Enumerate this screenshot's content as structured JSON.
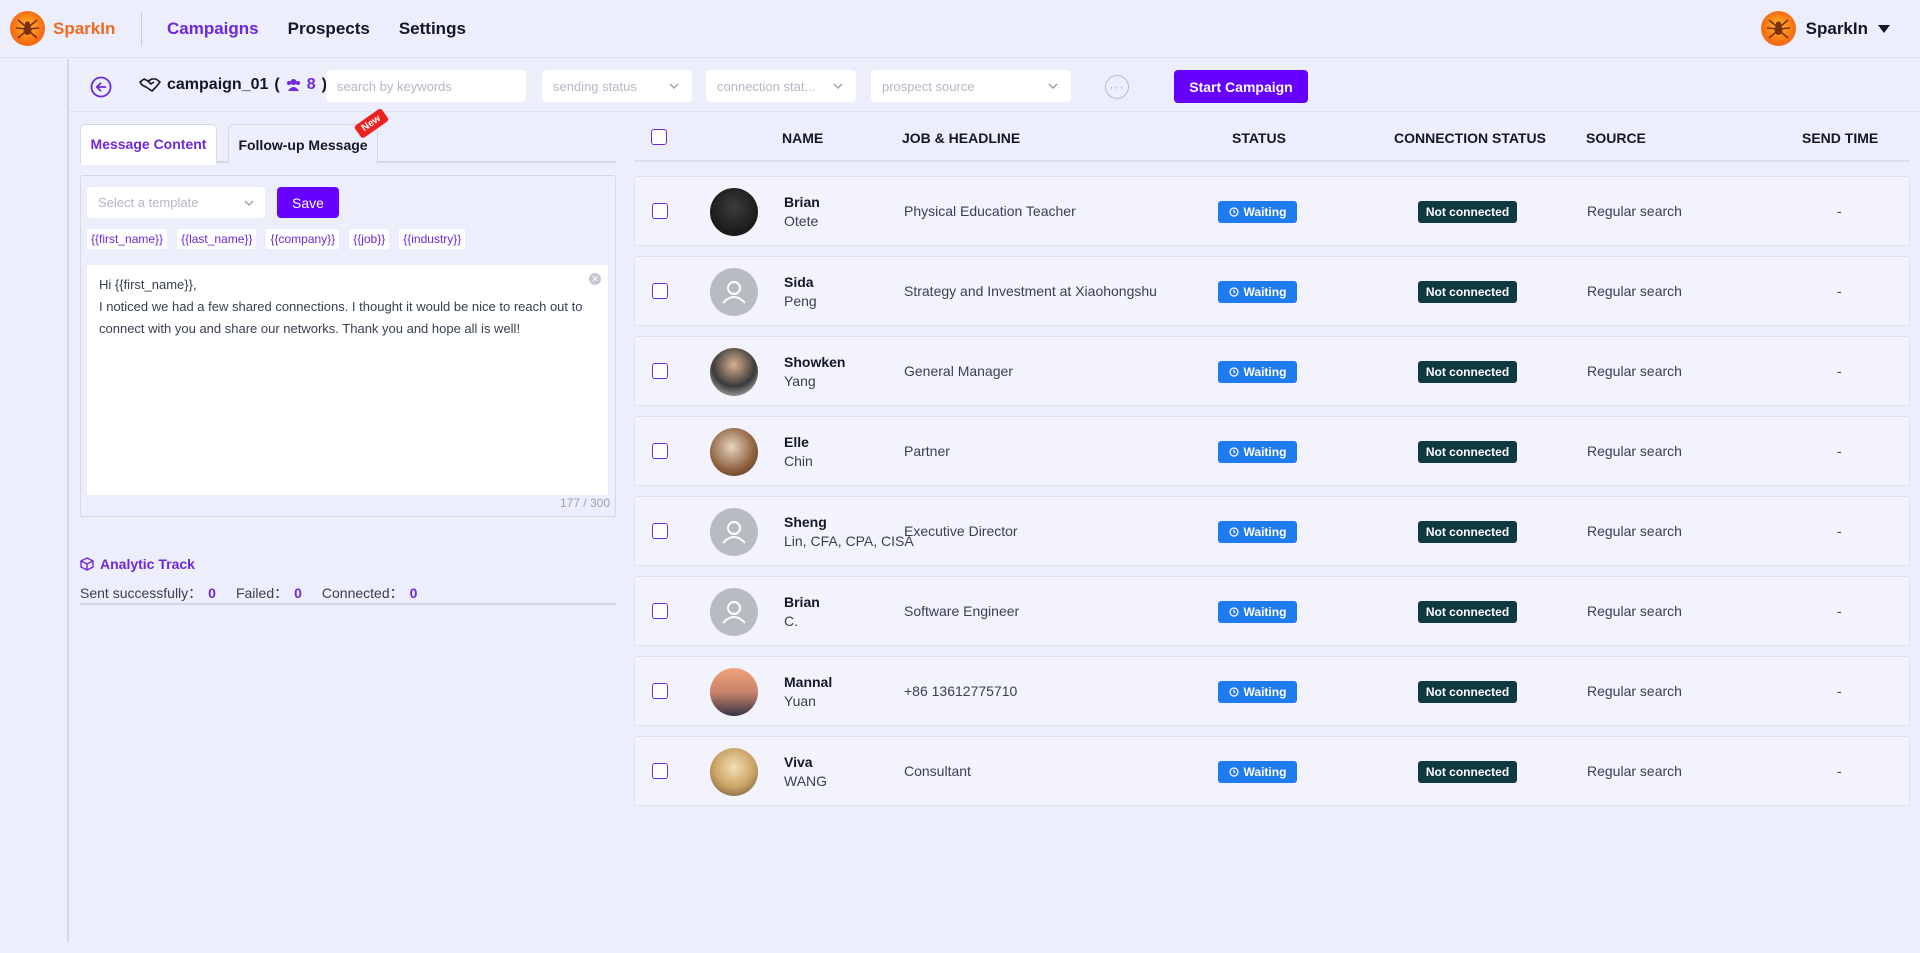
{
  "app": {
    "name": "SparkIn"
  },
  "nav": {
    "campaigns": "Campaigns",
    "prospects": "Prospects",
    "settings": "Settings"
  },
  "user": {
    "name": "SparkIn"
  },
  "toolbar": {
    "campaign_name": "campaign_01",
    "prospect_count": "8",
    "search_placeholder": "search by keywords",
    "sending_status_placeholder": "sending status",
    "connection_status_placeholder": "connection stat...",
    "prospect_source_placeholder": "prospect source",
    "more_label": "···",
    "start_label": "Start Campaign"
  },
  "message": {
    "tab_content": "Message Content",
    "tab_followup": "Follow-up Message",
    "new_badge": "New",
    "template_placeholder": "Select a template",
    "save_label": "Save",
    "tokens": [
      "{{first_name}}",
      "{{last_name}}",
      "{{company}}",
      "{{job}}",
      "{{industry}}"
    ],
    "body_line1": "Hi {{first_name}},",
    "body_line2": "I noticed we had a few shared connections. I thought it would be nice to reach out to connect with you and share our networks. Thank you and hope all is well!",
    "char_count": "177 / 300"
  },
  "analytic": {
    "title": "Analytic Track",
    "sent_label": "Sent successfully：",
    "sent_value": "0",
    "failed_label": "Failed：",
    "failed_value": "0",
    "connected_label": "Connected：",
    "connected_value": "0"
  },
  "table": {
    "headers": {
      "name": "NAME",
      "job": "JOB & HEADLINE",
      "status": "STATUS",
      "connection": "CONNECTION STATUS",
      "source": "SOURCE",
      "send_time": "SEND TIME"
    },
    "rows": [
      {
        "first": "Brian",
        "last": "Otete",
        "job": "Physical Education Teacher",
        "status": "Waiting",
        "connection": "Not connected",
        "source": "Regular search",
        "send_time": "-",
        "avatar": "photo"
      },
      {
        "first": "Sida",
        "last": "Peng",
        "job": "Strategy and Investment at Xiaohongshu",
        "status": "Waiting",
        "connection": "Not connected",
        "source": "Regular search",
        "send_time": "-",
        "avatar": "default"
      },
      {
        "first": "Showken",
        "last": "Yang",
        "job": "General Manager",
        "status": "Waiting",
        "connection": "Not connected",
        "source": "Regular search",
        "send_time": "-",
        "avatar": "photo"
      },
      {
        "first": "Elle",
        "last": "Chin",
        "job": "Partner",
        "status": "Waiting",
        "connection": "Not connected",
        "source": "Regular search",
        "send_time": "-",
        "avatar": "photo"
      },
      {
        "first": "Sheng",
        "last": "Lin, CFA, CPA, CISA",
        "job": "Executive Director",
        "status": "Waiting",
        "connection": "Not connected",
        "source": "Regular search",
        "send_time": "-",
        "avatar": "default"
      },
      {
        "first": "Brian",
        "last": "C.",
        "job": "Software Engineer",
        "status": "Waiting",
        "connection": "Not connected",
        "source": "Regular search",
        "send_time": "-",
        "avatar": "default"
      },
      {
        "first": "Mannal",
        "last": "Yuan",
        "job": "+86 13612775710",
        "status": "Waiting",
        "connection": "Not connected",
        "source": "Regular search",
        "send_time": "-",
        "avatar": "photo"
      },
      {
        "first": "Viva",
        "last": "WANG",
        "job": "Consultant",
        "status": "Waiting",
        "connection": "Not connected",
        "source": "Regular search",
        "send_time": "-",
        "avatar": "photo"
      }
    ]
  },
  "colors": {
    "accent": "#6600ff",
    "brand": "#f06a23",
    "status_waiting": "#1e7bf0",
    "not_connected": "#0f3a44"
  }
}
